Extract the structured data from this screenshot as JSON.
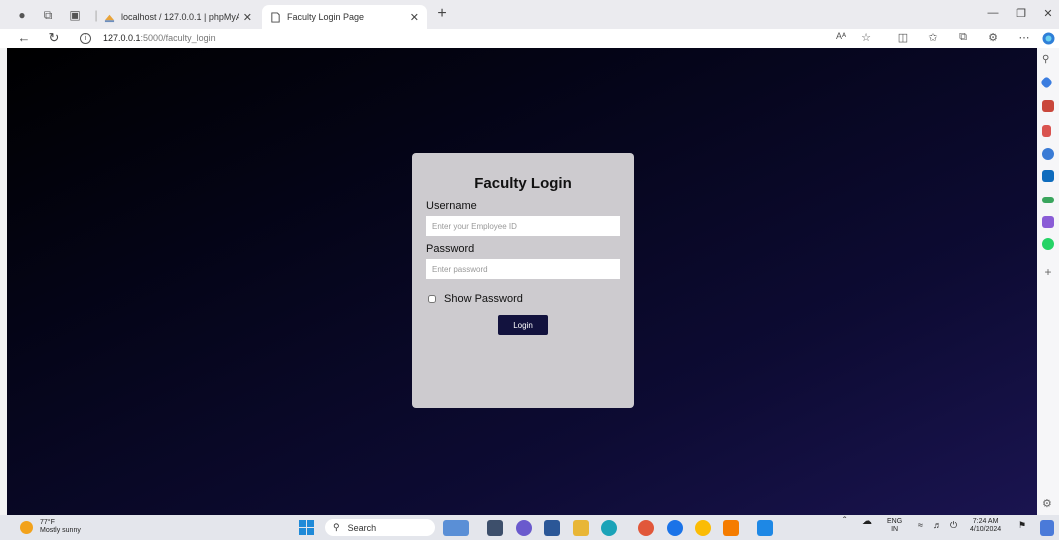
{
  "browser": {
    "tabs": [
      {
        "title": "localhost / 127.0.0.1 | phpMyAdm",
        "active": false
      },
      {
        "title": "Faculty Login Page",
        "active": true
      }
    ],
    "address": {
      "host": "127.0.0.1",
      "path": ":5000/faculty_login"
    },
    "icons": [
      "profile-icon",
      "collections-icon",
      "tab-actions-icon",
      "new-tab-icon",
      "back-icon",
      "refresh-icon",
      "info-icon",
      "read-aloud-icon",
      "favorite-icon",
      "split-screen-icon",
      "favorites-bar-icon",
      "collections-icon",
      "extensions-icon",
      "more-icon",
      "copilot-icon"
    ],
    "read_aloud_label": "Aᴬ"
  },
  "login": {
    "title": "Faculty Login",
    "username_label": "Username",
    "username_placeholder": "Enter your Employee ID",
    "password_label": "Password",
    "password_placeholder": "Enter password",
    "show_password_label": "Show Password",
    "button_label": "Login"
  },
  "taskbar": {
    "weather_temp": "77°F",
    "weather_desc": "Mostly sunny",
    "search_label": "Search",
    "lang_top": "ENG",
    "lang_bottom": "IN",
    "time": "7:24 AM",
    "date": "4/10/2024"
  },
  "colors": {
    "page_bg_start": "#000000",
    "page_bg_end": "#1a1450",
    "card_bg": "#cdcbcf",
    "button_bg": "#12123e"
  }
}
